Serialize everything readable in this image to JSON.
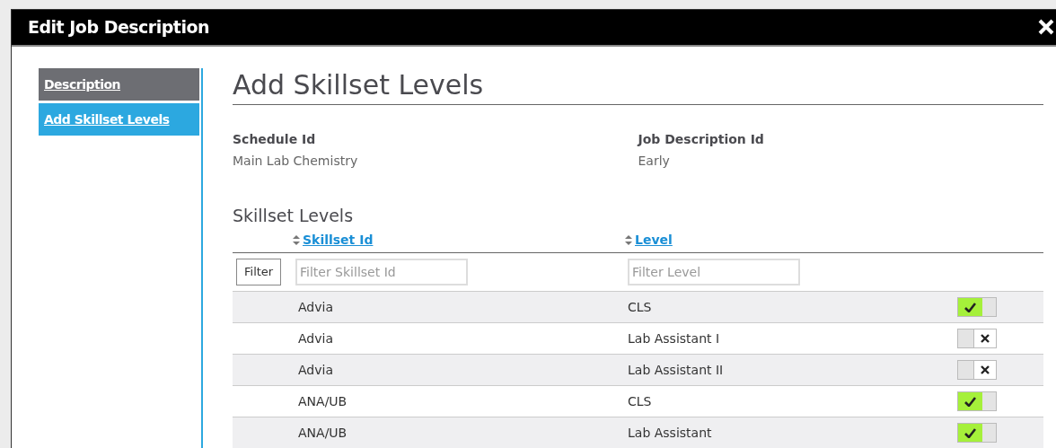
{
  "window": {
    "title": "Edit Job Description"
  },
  "sidebar": {
    "items": [
      {
        "label": "Description",
        "selected": false
      },
      {
        "label": "Add Skillset Levels",
        "selected": true
      }
    ]
  },
  "heading": "Add Skillset Levels",
  "fields": [
    {
      "label": "Schedule Id",
      "value": "Main Lab Chemistry"
    },
    {
      "label": "Job Description Id",
      "value": "Early"
    }
  ],
  "table": {
    "title": "Skillset Levels",
    "filter_button": "Filter",
    "columns": [
      {
        "label": "Skillset Id",
        "placeholder": "Filter Skillset Id"
      },
      {
        "label": "Level",
        "placeholder": "Filter Level"
      }
    ],
    "rows": [
      {
        "skillset": "Advia",
        "level": "CLS",
        "on": true
      },
      {
        "skillset": "Advia",
        "level": "Lab Assistant I",
        "on": false
      },
      {
        "skillset": "Advia",
        "level": "Lab Assistant II",
        "on": false
      },
      {
        "skillset": "ANA/UB",
        "level": "CLS",
        "on": true
      },
      {
        "skillset": "ANA/UB",
        "level": "Lab Assistant",
        "on": true
      }
    ]
  }
}
